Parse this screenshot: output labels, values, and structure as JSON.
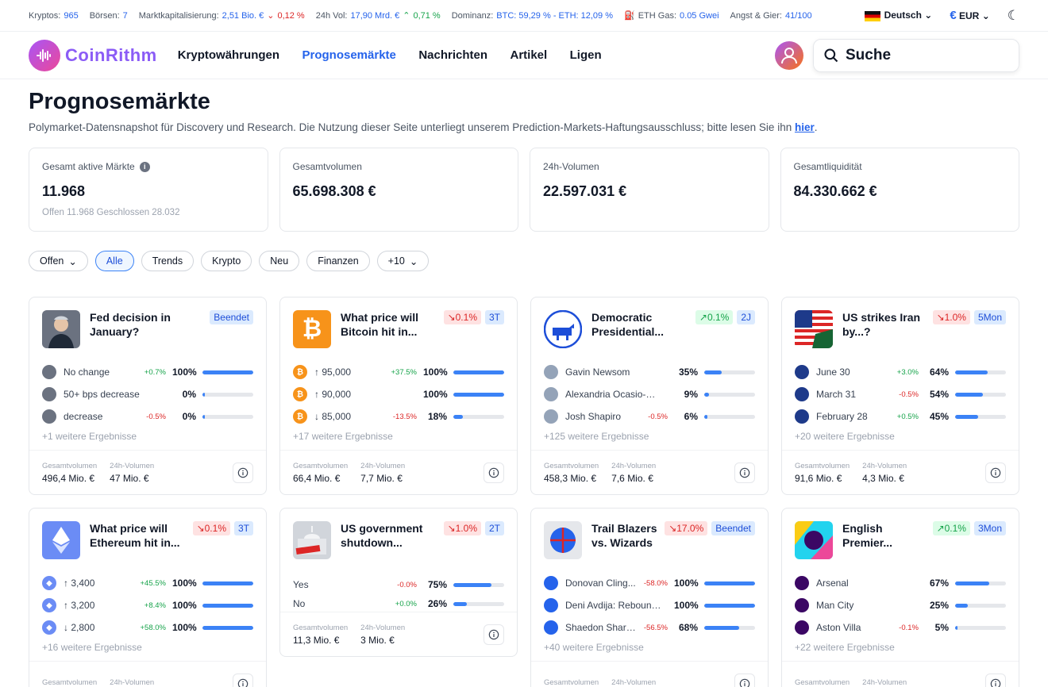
{
  "ticker": {
    "cryptos_label": "Kryptos:",
    "cryptos": "965",
    "exchanges_label": "Börsen:",
    "exchanges": "7",
    "mcap_label": "Marktkapitalisierung:",
    "mcap": "2,51 Bio. €",
    "mcap_change": "0,12 %",
    "vol_label": "24h Vol:",
    "vol": "17,90 Mrd. €",
    "vol_change": "0,71 %",
    "dom_label": "Dominanz:",
    "dom": "BTC: 59,29 % - ETH: 12,09 %",
    "gas_label": "ETH Gas:",
    "gas": "0.05 Gwei",
    "fg_label": "Angst & Gier:",
    "fg": "41/100",
    "language": "Deutsch",
    "currency": "EUR"
  },
  "nav": {
    "brand": "CoinRithm",
    "items": [
      "Kryptowährungen",
      "Prognosemärkte",
      "Nachrichten",
      "Artikel",
      "Ligen"
    ],
    "search": "Suche"
  },
  "page": {
    "title": "Prognosemärkte",
    "subtitle": "Polymarket-Datensnapshot für Discovery und Research. Die Nutzung dieser Seite unterliegt unserem Prediction-Markets-Haftungsausschluss; bitte lesen Sie ihn ",
    "subtitle_link": "hier",
    "subtitle_end": "."
  },
  "stats": [
    {
      "label": "Gesamt aktive Märkte",
      "value": "11.968",
      "sub": "Offen 11.968   Geschlossen 28.032"
    },
    {
      "label": "Gesamtvolumen",
      "value": "65.698.308 €",
      "sub": ""
    },
    {
      "label": "24h-Volumen",
      "value": "22.597.031 €",
      "sub": ""
    },
    {
      "label": "Gesamtliquidität",
      "value": "84.330.662 €",
      "sub": ""
    }
  ],
  "filters": [
    "Offen",
    "Alle",
    "Trends",
    "Krypto",
    "Neu",
    "Finanzen",
    "+10"
  ],
  "foot_labels": {
    "total": "Gesamtvolumen",
    "day": "24h-Volumen"
  },
  "cards": [
    {
      "title": "Fed decision in January?",
      "badges": [
        {
          "t": "Beendet",
          "c": "blue"
        }
      ],
      "thumb": "fed",
      "rows": [
        {
          "n": "No change",
          "c": "+0.7%",
          "p": "100%",
          "v": 1
        },
        {
          "n": "50+ bps decrease",
          "c": "",
          "p": "0%",
          "v": 0
        },
        {
          "n": "decrease",
          "c": "-0.5%",
          "p": "0%",
          "v": 0
        }
      ],
      "more": "+1 weitere Ergebnisse",
      "total": "496,4 Mio. €",
      "day": "47 Mio. €"
    },
    {
      "title": "What price will Bitcoin hit in...",
      "badges": [
        {
          "t": "↘0.1%",
          "c": "red"
        },
        {
          "t": "3T",
          "c": "blue"
        }
      ],
      "thumb": "btc",
      "rows": [
        {
          "n": "↑ 95,000",
          "c": "+37.5%",
          "p": "100%",
          "v": 1
        },
        {
          "n": "↑ 90,000",
          "c": "",
          "p": "100%",
          "v": 1
        },
        {
          "n": "↓ 85,000",
          "c": "-13.5%",
          "p": "18%",
          "v": 0.18
        }
      ],
      "more": "+17 weitere Ergebnisse",
      "total": "66,4 Mio. €",
      "day": "7,7 Mio. €"
    },
    {
      "title": "Democratic Presidential...",
      "badges": [
        {
          "t": "↗0.1%",
          "c": "green"
        },
        {
          "t": "2J",
          "c": "blue"
        }
      ],
      "thumb": "dem",
      "rows": [
        {
          "n": "Gavin Newsom",
          "c": "",
          "p": "35%",
          "v": 0.35
        },
        {
          "n": "Alexandria Ocasio-Cortez",
          "c": "",
          "p": "9%",
          "v": 0.09
        },
        {
          "n": "Josh Shapiro",
          "c": "-0.5%",
          "p": "6%",
          "v": 0.06
        }
      ],
      "more": "+125 weitere Ergebnisse",
      "total": "458,3 Mio. €",
      "day": "7,6 Mio. €"
    },
    {
      "title": "US strikes Iran by...?",
      "badges": [
        {
          "t": "↘1.0%",
          "c": "red"
        },
        {
          "t": "5Mon",
          "c": "blue"
        }
      ],
      "thumb": "usiran",
      "rows": [
        {
          "n": "June 30",
          "c": "+3.0%",
          "p": "64%",
          "v": 0.64
        },
        {
          "n": "March 31",
          "c": "-0.5%",
          "p": "54%",
          "v": 0.54
        },
        {
          "n": "February 28",
          "c": "+0.5%",
          "p": "45%",
          "v": 0.45
        }
      ],
      "more": "+20 weitere Ergebnisse",
      "total": "91,6 Mio. €",
      "day": "4,3 Mio. €"
    },
    {
      "title": "What price will Ethereum hit in...",
      "badges": [
        {
          "t": "↘0.1%",
          "c": "red"
        },
        {
          "t": "3T",
          "c": "blue"
        }
      ],
      "thumb": "eth",
      "rows": [
        {
          "n": "↑ 3,400",
          "c": "+45.5%",
          "p": "100%",
          "v": 1
        },
        {
          "n": "↑ 3,200",
          "c": "+8.4%",
          "p": "100%",
          "v": 1
        },
        {
          "n": "↓ 2,800",
          "c": "+58.0%",
          "p": "100%",
          "v": 1
        }
      ],
      "more": "+16 weitere Ergebnisse",
      "total": "",
      "day": ""
    },
    {
      "title": "US government shutdown...",
      "badges": [
        {
          "t": "↘1.0%",
          "c": "red"
        },
        {
          "t": "2T",
          "c": "blue"
        }
      ],
      "thumb": "gov",
      "rows": [
        {
          "n": "Yes",
          "c": "-0.0%",
          "p": "75%",
          "v": 0.75
        },
        {
          "n": "No",
          "c": "+0.0%",
          "p": "26%",
          "v": 0.26
        }
      ],
      "more": "",
      "total": "11,3 Mio. €",
      "day": "3 Mio. €"
    },
    {
      "title": "Trail Blazers vs. Wizards",
      "badges": [
        {
          "t": "↘17.0%",
          "c": "red"
        },
        {
          "t": "Beendet",
          "c": "blue"
        }
      ],
      "thumb": "nba",
      "rows": [
        {
          "n": "Donovan Cling...",
          "c": "-58.0%",
          "p": "100%",
          "v": 1
        },
        {
          "n": "Deni Avdija: Rebounds...",
          "c": "",
          "p": "100%",
          "v": 1
        },
        {
          "n": "Shaedon Sharp...",
          "c": "-56.5%",
          "p": "68%",
          "v": 0.68
        }
      ],
      "more": "+40 weitere Ergebnisse",
      "total": "",
      "day": ""
    },
    {
      "title": "English Premier...",
      "badges": [
        {
          "t": "↗0.1%",
          "c": "green"
        },
        {
          "t": "3Mon",
          "c": "blue"
        }
      ],
      "thumb": "epl",
      "rows": [
        {
          "n": "Arsenal",
          "c": "",
          "p": "67%",
          "v": 0.67
        },
        {
          "n": "Man City",
          "c": "",
          "p": "25%",
          "v": 0.25
        },
        {
          "n": "Aston Villa",
          "c": "-0.1%",
          "p": "5%",
          "v": 0.05
        }
      ],
      "more": "+22 weitere Ergebnisse",
      "total": "",
      "day": ""
    }
  ]
}
